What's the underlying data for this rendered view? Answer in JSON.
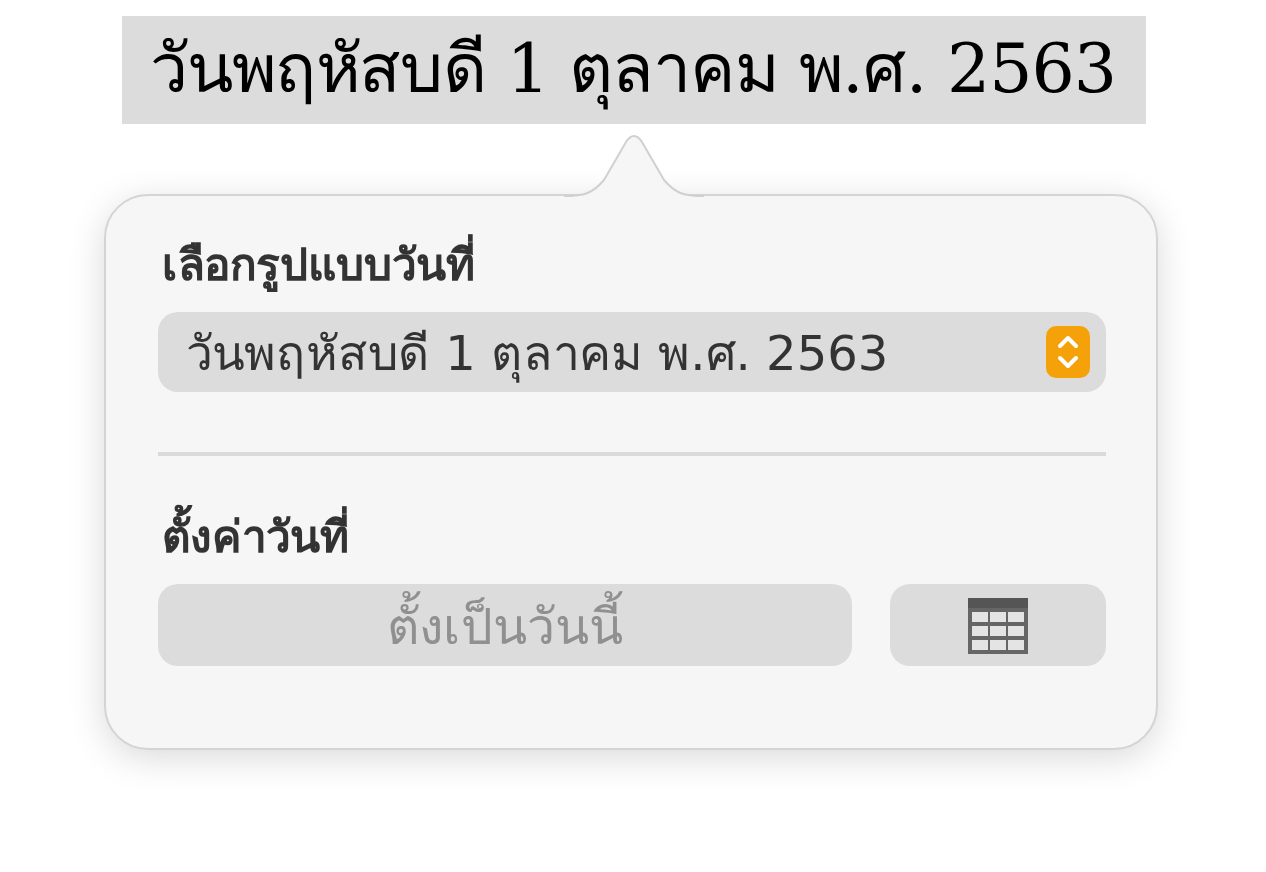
{
  "date_text": "วันพฤหัสบดี 1 ตุลาคม พ.ศ. 2563",
  "popover": {
    "format_label": "เลือกรูปแบบวันที่",
    "format_select": {
      "value": "วันพฤหัสบดี 1 ตุลาคม พ.ศ. 2563"
    },
    "set_label": "ตั้งค่าวันที่",
    "today_button": {
      "label": "ตั้งเป็นวันนี้",
      "disabled": true
    }
  }
}
